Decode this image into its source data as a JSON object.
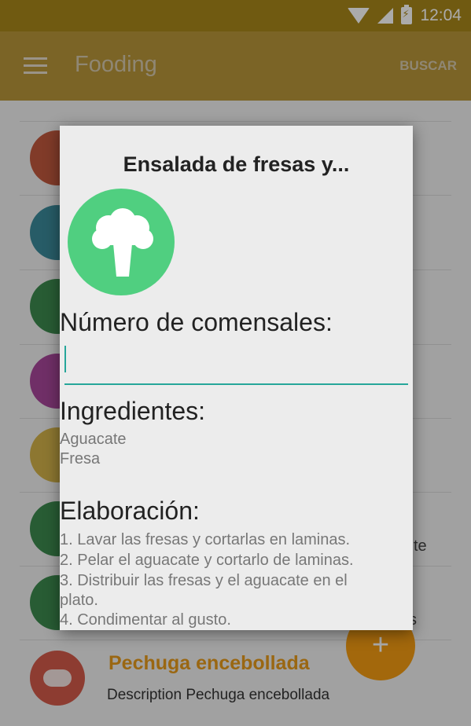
{
  "status_bar": {
    "time": "12:04",
    "icons": [
      "wifi-icon",
      "cellular-signal-icon",
      "battery-charging-icon"
    ]
  },
  "app_bar": {
    "title": "Fooding",
    "search_label": "BUSCAR",
    "menu_icon": "hamburger-menu-icon",
    "color": "#b8953a"
  },
  "background_list": {
    "visible_item": {
      "title": "Pechuga encebollada",
      "description": "Description Pechuga encebollada"
    },
    "peek_fragments": [
      "te",
      "s"
    ],
    "fab_label": "+",
    "avatar_colors": [
      "#c0583e",
      "#3b8a9a",
      "#3c8a4e",
      "#a8479a",
      "#d3b24a",
      "#3c8a4e",
      "#3c8a4e",
      "#d35a4a"
    ]
  },
  "dialog": {
    "title": "Ensalada de fresas y...",
    "image_icon": "broccoli-icon",
    "image_color": "#50cf80",
    "diners_label": "Número de comensales:",
    "diners_value": "",
    "ingredients_label": "Ingredientes:",
    "ingredients": [
      "Aguacate",
      "Fresa"
    ],
    "elaboration_label": "Elaboración:",
    "steps": [
      "1. Lavar las fresas y cortarlas en laminas.",
      "2. Pelar el aguacate y cortarlo de laminas.",
      "3. Distribuir las fresas y el aguacate en el",
      "plato.",
      "4. Condimentar al gusto."
    ]
  }
}
